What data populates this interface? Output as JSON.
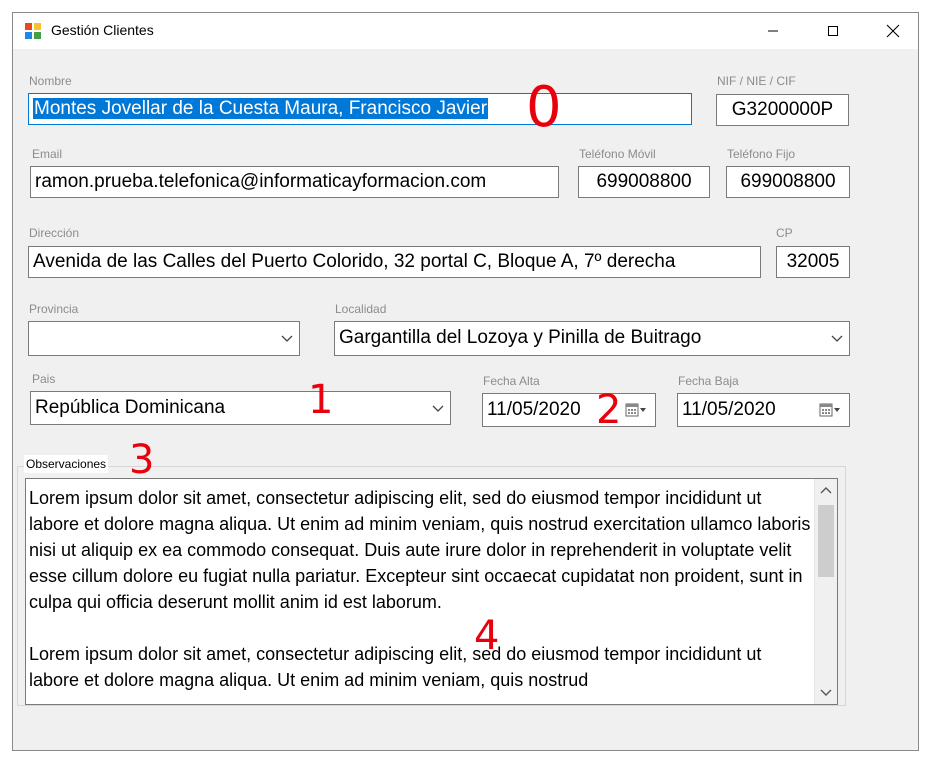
{
  "window": {
    "title": "Gestión Clientes",
    "icons": [
      "app-form-icon",
      "minimize-icon",
      "maximize-icon",
      "close-icon"
    ]
  },
  "form": {
    "nombre": {
      "label": "Nombre",
      "value": "Montes Jovellar de la Cuesta Maura, Francisco Javier"
    },
    "nif": {
      "label": "NIF / NIE / CIF",
      "value": "G3200000P"
    },
    "email": {
      "label": "Email",
      "value": "ramon.prueba.telefonica@informaticayformacion.com"
    },
    "telefono_movil": {
      "label": "Teléfono Móvil",
      "value": "699008800"
    },
    "telefono_fijo": {
      "label": "Teléfono Fijo",
      "value": "699008800"
    },
    "direccion": {
      "label": "Dirección",
      "value": "Avenida de las Calles del Puerto Colorido, 32 portal C, Bloque A, 7º derecha"
    },
    "cp": {
      "label": "CP",
      "value": "32005"
    },
    "provincia": {
      "label": "Provincia",
      "value": ""
    },
    "localidad": {
      "label": "Localidad",
      "value": "Gargantilla del Lozoya y Pinilla de Buitrago"
    },
    "pais": {
      "label": "Pais",
      "value": "República Dominicana"
    },
    "fecha_alta": {
      "label": "Fecha Alta",
      "value": "11/05/2020"
    },
    "fecha_baja": {
      "label": "Fecha Baja",
      "value": "11/05/2020"
    },
    "observaciones": {
      "label": "Observaciones",
      "value": "Lorem ipsum dolor sit amet, consectetur adipiscing elit, sed do eiusmod tempor incididunt ut labore et dolore magna aliqua. Ut enim ad minim veniam, quis nostrud exercitation ullamco laboris nisi ut aliquip ex ea commodo consequat. Duis aute irure dolor in reprehenderit in voluptate velit esse cillum dolore eu fugiat nulla pariatur. Excepteur sint occaecat cupidatat non proident, sunt in culpa qui officia deserunt mollit anim id est laborum.\n\nLorem ipsum dolor sit amet, consectetur adipiscing elit, sed do eiusmod tempor incididunt ut labore et dolore magna aliqua. Ut enim ad minim veniam, quis nostrud"
    }
  },
  "annotations": [
    "0",
    "1",
    "2",
    "3",
    "4"
  ],
  "colors": {
    "selection": "#0078d7",
    "annotation": "#e8000c",
    "window_bg": "#f0f0f0"
  }
}
